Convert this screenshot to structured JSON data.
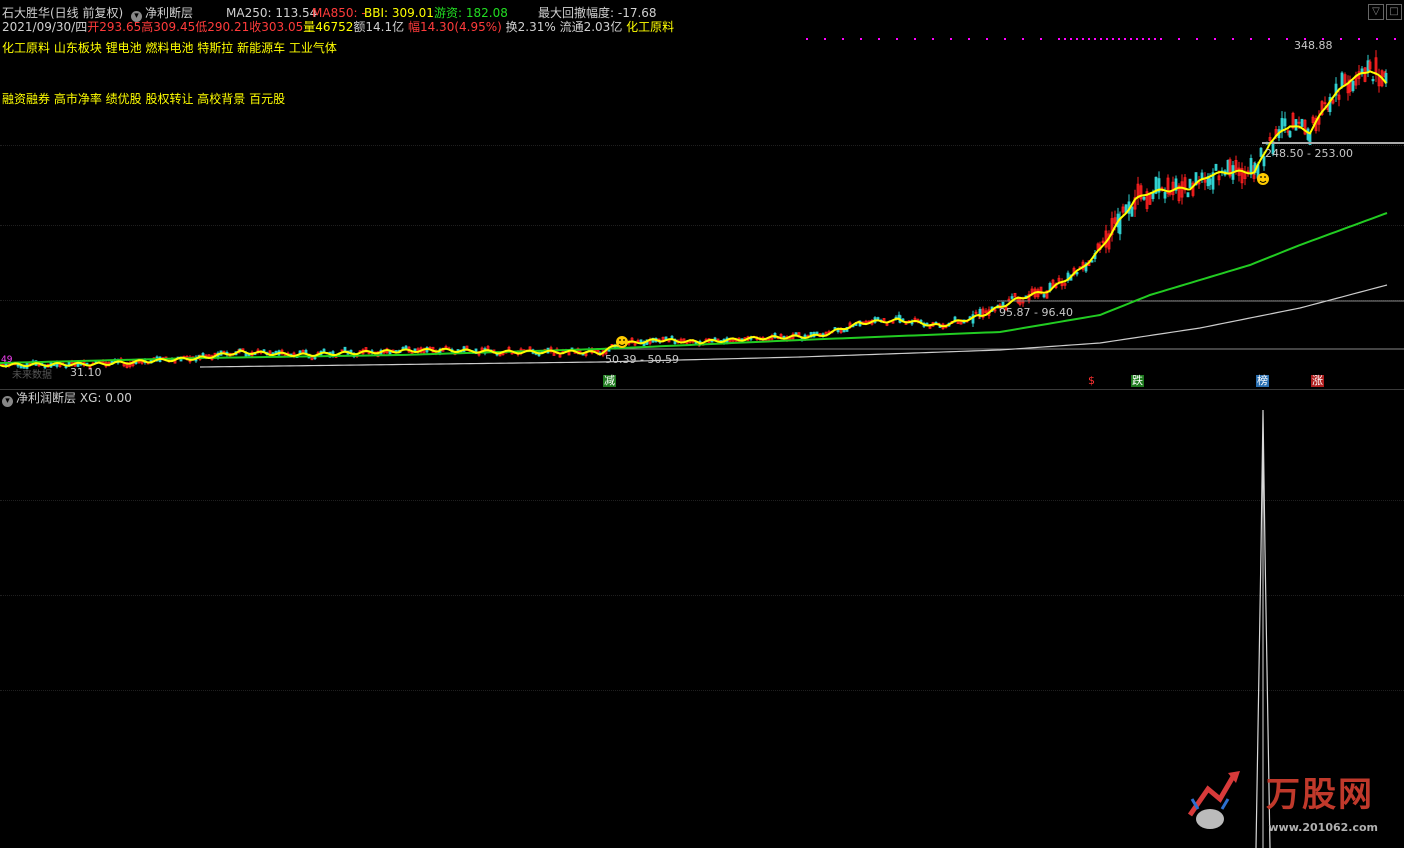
{
  "header": {
    "stock_name": "石大胜华(日线 前复权)",
    "indicator_name": "净利断层",
    "ma250": "MA250: 113.54",
    "ma850": "MA850: -",
    "bbi": "BBI: 309.01",
    "youzi": "游资: 182.08",
    "max_drawdown": "最大回撤幅度: -17.68",
    "date": "2021/09/30/四",
    "open": "开293.65",
    "high": "高309.45",
    "low": "低290.21",
    "close": "收303.05",
    "volume": "量46752",
    "amount": "额14.1亿",
    "change": "幅14.30(4.95%)",
    "turnover": "换2.31%",
    "float": "流通2.03亿",
    "sector": "化工原料"
  },
  "tags_line1": "化工原料 山东板块 锂电池 燃料电池 特斯拉 新能源车 工业气体",
  "tags_line2": "融资融券 高市净率 绩优股 股权转让 高校背景 百元股",
  "price_labels": {
    "high_price": "348.88",
    "gap_top": "248.50 - 253.00",
    "gap_mid": "95.87 - 96.40",
    "gap_low": "50.39 - 50.59",
    "low_price": "31.10",
    "faded_text": "未来数据",
    "left_num": "49"
  },
  "signals": {
    "jian": "减",
    "s": "$",
    "die": "跌",
    "bang": "榜",
    "zhang": "涨"
  },
  "lower_panel": {
    "title": "净利润断层",
    "xg": "XG: 0.00"
  },
  "watermark": {
    "brand": "万股网",
    "url": "www.201062.com"
  },
  "colors": {
    "ma_short": "#ffff00",
    "ma_mid": "#22cc22",
    "ma_long": "#cccccc",
    "up": "#ff2020",
    "down": "#30d0d0",
    "marker": "#ff00ff"
  }
}
